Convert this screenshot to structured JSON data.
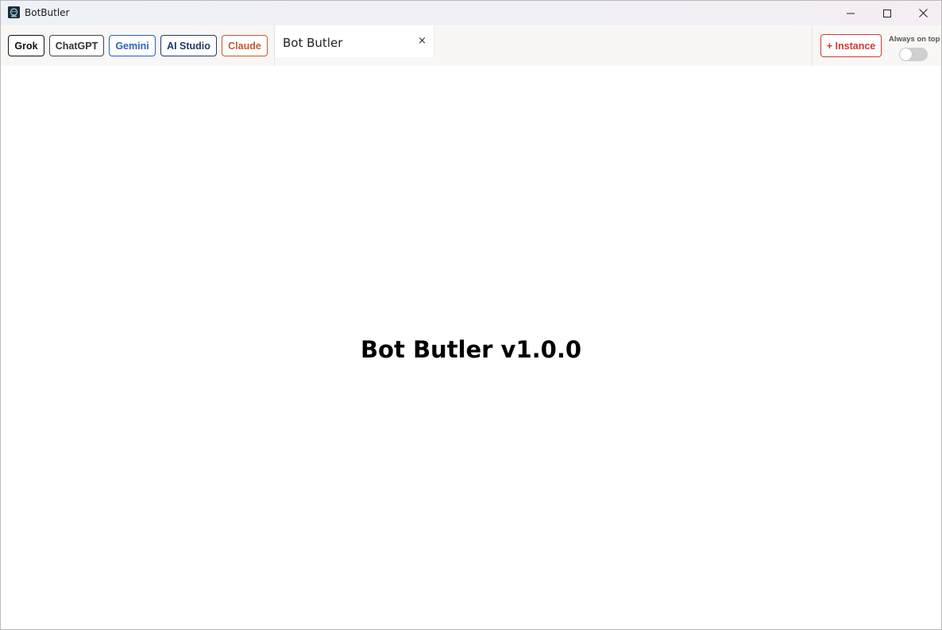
{
  "window": {
    "title": "BotButler",
    "icon": "botbutler-app-icon",
    "controls": [
      "minimize-icon",
      "maximize-icon",
      "close-icon"
    ]
  },
  "toolbar": {
    "services": [
      {
        "label": "Grok",
        "color": "#111111"
      },
      {
        "label": "ChatGPT",
        "color": "#333333"
      },
      {
        "label": "Gemini",
        "color": "#2a64b8"
      },
      {
        "label": "AI Studio",
        "color": "#1f3a66"
      },
      {
        "label": "Claude",
        "color": "#c45a30"
      }
    ],
    "tabs": [
      {
        "label": "Bot Butler",
        "close": "×",
        "active": true
      }
    ],
    "instance_button": "+ Instance",
    "always_on_top": {
      "label": "Always on top",
      "enabled": false
    }
  },
  "main": {
    "heading": "Bot Butler v1.0.0"
  },
  "colors": {
    "accent_red": "#d03a32",
    "toolbar_bg": "#f8f7f6"
  }
}
